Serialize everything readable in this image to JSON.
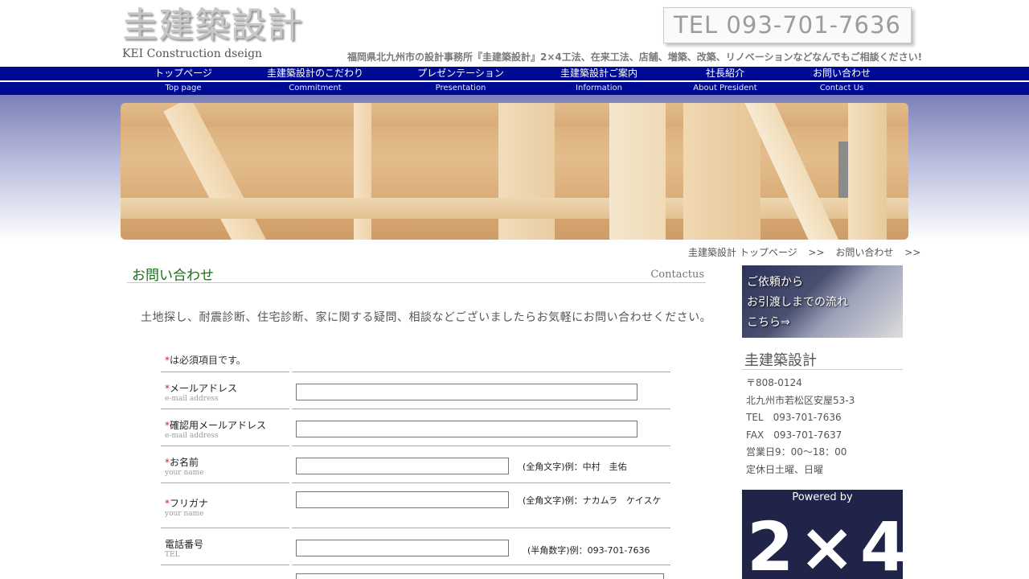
{
  "header": {
    "logo_jp": "圭建築設計",
    "logo_en": "KEI Construction dseign",
    "tel": "TEL 093-701-7636",
    "tagline": "福岡県北九州市の設計事務所『圭建築設計』2×4工法、在来工法、店舗、増築、改築、リノベーションなどなんでもご相談ください!"
  },
  "nav": [
    {
      "jp": "トップページ",
      "en": "Top page"
    },
    {
      "jp": "圭建築設計のこだわり",
      "en": "Commitment"
    },
    {
      "jp": "プレゼンテーション",
      "en": "Presentation"
    },
    {
      "jp": "圭建築設計ご案内",
      "en": "Information"
    },
    {
      "jp": "社長紹介",
      "en": "About President"
    },
    {
      "jp": "お問い合わせ",
      "en": "Contact Us"
    }
  ],
  "breadcrumb": {
    "home": "圭建築設計 トップページ",
    "sep": ">>",
    "current": "お問い合わせ"
  },
  "section": {
    "title_jp": "お問い合わせ",
    "title_en": "Contactus",
    "intro": "土地探し、耐震診断、住宅診断、家に関する疑問、相談などございましたらお気軽にお問い合わせください。",
    "required_star": "*",
    "required_note": "は必須項目です。"
  },
  "form": {
    "email_label": "メールアドレス",
    "email_sub": "e-mail address",
    "confirm_label": "確認用メールアドレス",
    "confirm_sub": "e-mail address",
    "name_label": "お名前",
    "name_sub": "your name",
    "name_hint": "(全角文字)例：中村　圭佑",
    "kana_label": "フリガナ",
    "kana_sub": "your name",
    "kana_hint": "(全角文字)例：ナカムラ　ケイスケ",
    "tel_label": "電話番号",
    "tel_sub": "TEL",
    "tel_hint": "(半角数字)例：093-701-7636"
  },
  "sidebar": {
    "banner_lines": [
      "ご依頼から",
      "お引渡しまでの流れ",
      "こちら⇒"
    ],
    "company_name": "圭建築設計",
    "info": [
      "〒808-0124",
      "北九州市若松区安屋53-3",
      "TEL　093-701-7636",
      "FAX　093-701-7637",
      "営業日9：00～18：00",
      "定休日土曜、日曜"
    ],
    "powered_by": "Powered by",
    "powered_logo": "2×4"
  }
}
